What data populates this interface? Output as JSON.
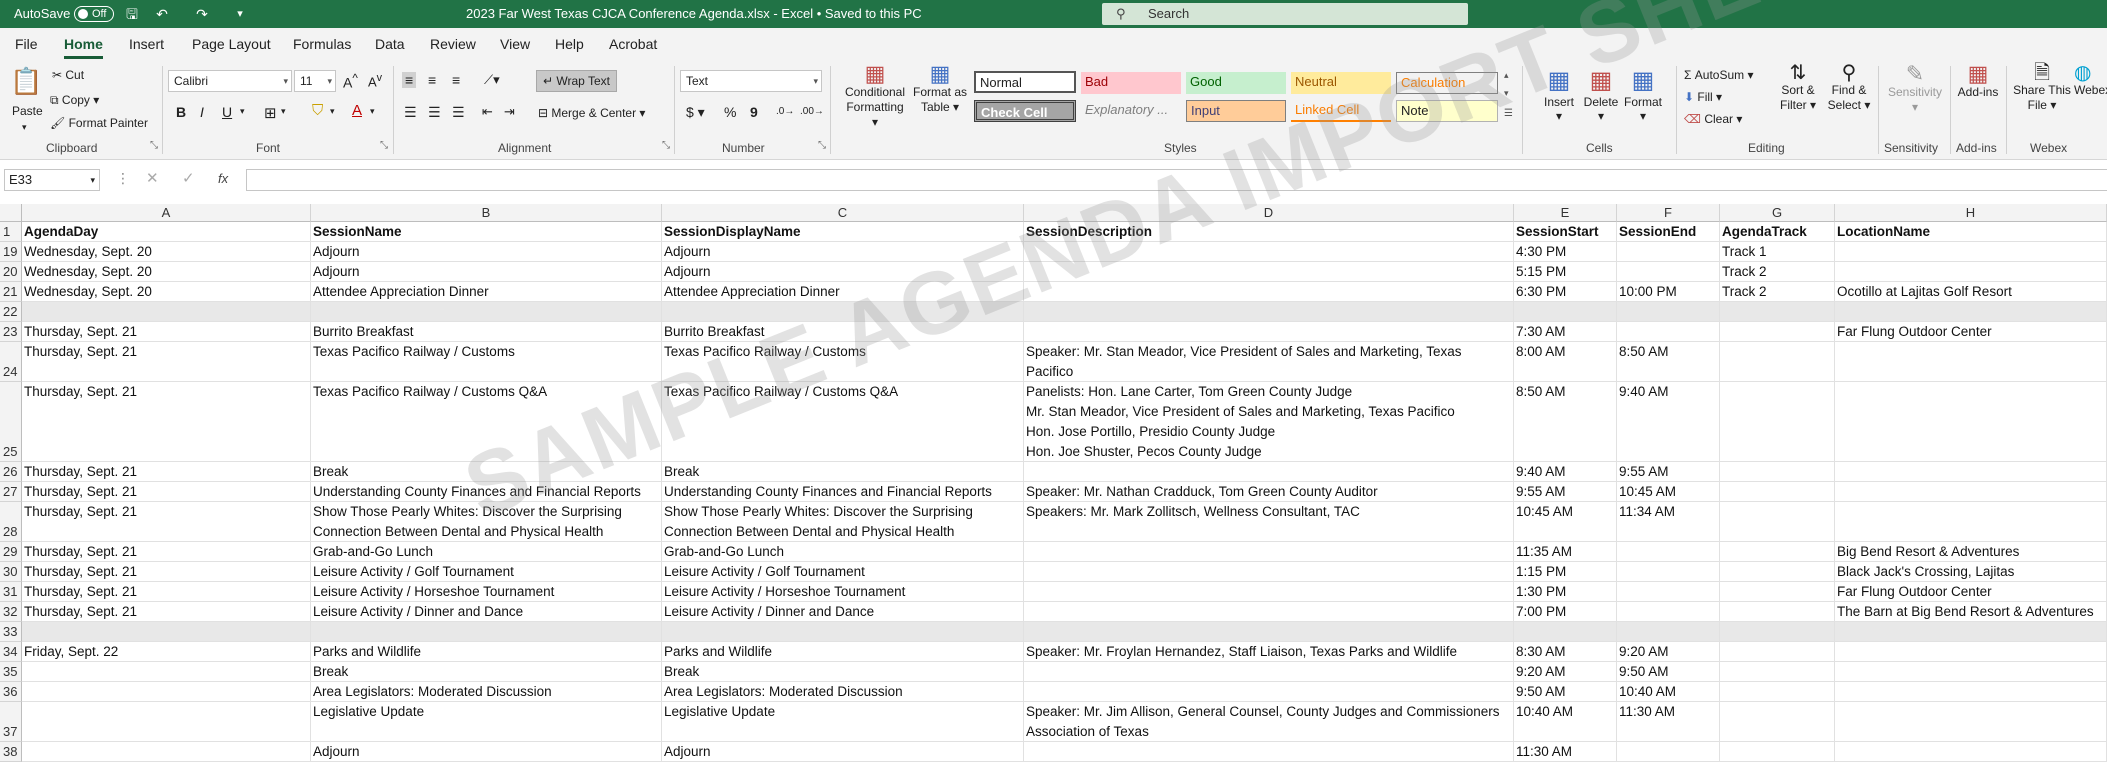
{
  "titlebar": {
    "autosave_label": "AutoSave",
    "autosave_state": "Off",
    "doc_title": "2023 Far West Texas CJCA Conference Agenda.xlsx  -  Excel  •  Saved to this PC",
    "search_placeholder": "Search"
  },
  "menu": {
    "tabs": [
      "File",
      "Home",
      "Insert",
      "Page Layout",
      "Formulas",
      "Data",
      "Review",
      "View",
      "Help",
      "Acrobat"
    ],
    "active": "Home"
  },
  "ribbon": {
    "clipboard": {
      "paste": "Paste",
      "cut": "Cut",
      "copy": "Copy",
      "format_painter": "Format Painter",
      "label": "Clipboard"
    },
    "font": {
      "name": "Calibri",
      "size": "11",
      "label": "Font",
      "bold": "B",
      "italic": "I",
      "underline": "U"
    },
    "alignment": {
      "wrap_text": "Wrap Text",
      "merge_center": "Merge & Center",
      "label": "Alignment"
    },
    "number": {
      "format": "Text",
      "label": "Number"
    },
    "styles": {
      "conditional": "Conditional Formatting",
      "format_table": "Format as Table",
      "cells": [
        "Normal",
        "Bad",
        "Good",
        "Neutral",
        "Calculation",
        "Check Cell",
        "Explanatory ...",
        "Input",
        "Linked Cell",
        "Note"
      ],
      "label": "Styles"
    },
    "cells": {
      "insert": "Insert",
      "delete": "Delete",
      "format": "Format",
      "label": "Cells"
    },
    "editing": {
      "autosum": "AutoSum",
      "fill": "Fill",
      "clear": "Clear",
      "sort_filter": "Sort & Filter",
      "find_select": "Find & Select",
      "label": "Editing"
    },
    "sensitivity": {
      "btn": "Sensitivity",
      "label": "Sensitivity"
    },
    "addins": {
      "btn": "Add-ins",
      "label": "Add-ins"
    },
    "webex": {
      "share": "Share This File",
      "webex": "Webex",
      "label": "Webex"
    },
    "colors": {
      "excel_green": "#217346",
      "tab_active": "#185c37"
    }
  },
  "formula_bar": {
    "name_box": "E33",
    "fx": "fx",
    "content": ""
  },
  "sheet": {
    "column_letters": [
      "A",
      "B",
      "C",
      "D",
      "E",
      "F",
      "G",
      "H"
    ],
    "headers": [
      "AgendaDay",
      "SessionName",
      "SessionDisplayName",
      "SessionDescription",
      "SessionStart",
      "SessionEnd",
      "AgendaTrack",
      "LocationName"
    ],
    "header_row_number": "1",
    "rows": [
      {
        "num": "19",
        "cells": [
          "Wednesday, Sept. 20",
          "Adjourn",
          "Adjourn",
          "",
          "4:30 PM",
          "",
          "Track 1",
          ""
        ]
      },
      {
        "num": "20",
        "cells": [
          "Wednesday, Sept. 20",
          "Adjourn",
          "Adjourn",
          "",
          "5:15 PM",
          "",
          "Track 2",
          ""
        ]
      },
      {
        "num": "21",
        "cells": [
          "Wednesday, Sept. 20",
          "Attendee Appreciation Dinner",
          "Attendee Appreciation Dinner",
          "",
          "6:30 PM",
          "10:00 PM",
          "Track 2",
          "Ocotillo at Lajitas Golf Resort"
        ]
      },
      {
        "num": "22",
        "cells": [
          "",
          "",
          "",
          "",
          "",
          "",
          "",
          ""
        ]
      },
      {
        "num": "23",
        "cells": [
          "Thursday, Sept. 21",
          "Burrito Breakfast",
          "Burrito Breakfast",
          "",
          "7:30 AM",
          "",
          "",
          "Far Flung Outdoor Center"
        ]
      },
      {
        "num": "24",
        "cells": [
          "Thursday, Sept. 21",
          "Texas Pacifico Railway / Customs",
          "Texas Pacifico Railway / Customs",
          "Speaker: Mr. Stan Meador, Vice President of Sales and Marketing, Texas Pacifico",
          "8:00 AM",
          "8:50 AM",
          "",
          ""
        ]
      },
      {
        "num": "25",
        "cells": [
          "Thursday, Sept. 21",
          "Texas Pacifico Railway / Customs Q&A",
          "Texas Pacifico Railway / Customs Q&A",
          "Panelists: Hon. Lane Carter, Tom Green County Judge\nMr. Stan Meador, Vice President of Sales and Marketing, Texas Pacifico\nHon. Jose Portillo, Presidio County Judge\nHon. Joe Shuster, Pecos County Judge",
          "8:50 AM",
          "9:40 AM",
          "",
          ""
        ]
      },
      {
        "num": "26",
        "cells": [
          "Thursday, Sept. 21",
          "Break",
          "Break",
          "",
          "9:40 AM",
          "9:55 AM",
          "",
          ""
        ]
      },
      {
        "num": "27",
        "cells": [
          "Thursday, Sept. 21",
          "Understanding County Finances and Financial Reports",
          "Understanding County Finances and Financial Reports",
          "Speaker: Mr. Nathan Cradduck, Tom Green County Auditor",
          "9:55 AM",
          "10:45 AM",
          "",
          ""
        ]
      },
      {
        "num": "28",
        "cells": [
          "Thursday, Sept. 21",
          "Show Those Pearly Whites: Discover the Surprising Connection Between Dental and Physical Health",
          "Show Those Pearly Whites: Discover the Surprising Connection Between Dental and Physical Health",
          "Speakers: Mr. Mark Zollitsch, Wellness Consultant, TAC",
          "10:45 AM",
          "11:34 AM",
          "",
          ""
        ]
      },
      {
        "num": "29",
        "cells": [
          "Thursday, Sept. 21",
          "Grab-and-Go Lunch",
          "Grab-and-Go Lunch",
          "",
          "11:35 AM",
          "",
          "",
          "Big Bend Resort & Adventures"
        ]
      },
      {
        "num": "30",
        "cells": [
          "Thursday, Sept. 21",
          "Leisure Activity / Golf Tournament",
          "Leisure Activity / Golf Tournament",
          "",
          "1:15 PM",
          "",
          "",
          "Black Jack's Crossing, Lajitas"
        ]
      },
      {
        "num": "31",
        "cells": [
          "Thursday, Sept. 21",
          "Leisure Activity / Horseshoe Tournament",
          "Leisure Activity / Horseshoe Tournament",
          "",
          "1:30 PM",
          "",
          "",
          "Far Flung Outdoor Center"
        ]
      },
      {
        "num": "32",
        "cells": [
          "Thursday, Sept. 21",
          "Leisure Activity / Dinner and Dance",
          "Leisure Activity / Dinner and Dance",
          "",
          "7:00 PM",
          "",
          "",
          "The Barn at Big Bend Resort & Adventures"
        ]
      },
      {
        "num": "33",
        "cells": [
          "",
          "",
          "",
          "",
          "",
          "",
          "",
          ""
        ]
      },
      {
        "num": "34",
        "cells": [
          "Friday, Sept. 22",
          "Parks and Wildlife",
          "Parks and Wildlife",
          "Speaker: Mr. Froylan Hernandez, Staff Liaison, Texas Parks and Wildlife",
          "8:30 AM",
          "9:20 AM",
          "",
          ""
        ]
      },
      {
        "num": "35",
        "cells": [
          "",
          "Break",
          "Break",
          "",
          "9:20 AM",
          "9:50 AM",
          "",
          ""
        ]
      },
      {
        "num": "36",
        "cells": [
          "",
          "Area Legislators: Moderated Discussion",
          "Area Legislators: Moderated Discussion",
          "",
          "9:50 AM",
          "10:40 AM",
          "",
          ""
        ]
      },
      {
        "num": "37",
        "cells": [
          "",
          "Legislative Update",
          "Legislative Update",
          "Speaker: Mr. Jim Allison, General Counsel, County Judges and Commissioners Association of Texas",
          "10:40 AM",
          "11:30 AM",
          "",
          ""
        ]
      },
      {
        "num": "38",
        "cells": [
          "",
          "Adjourn",
          "Adjourn",
          "",
          "11:30 AM",
          "",
          "",
          ""
        ]
      }
    ],
    "watermark": "SAMPLE AGENDA IMPORT SHEET"
  }
}
